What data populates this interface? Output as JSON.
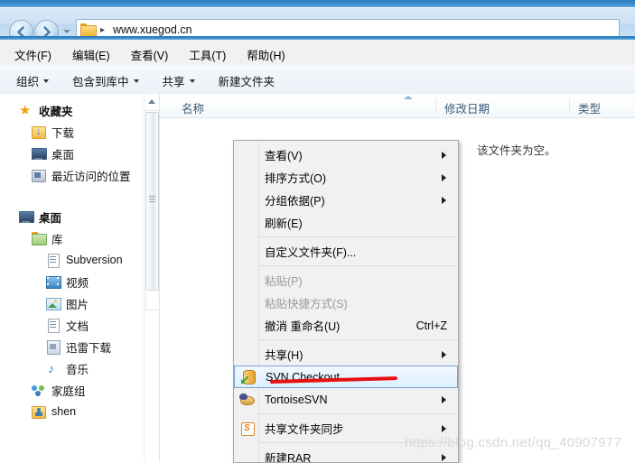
{
  "window": {
    "address_path": "www.xuegod.cn",
    "path_separator": "▸",
    "back_icon": "back-arrow-icon",
    "forward_icon": "forward-arrow-icon",
    "history_dropdown_icon": "chevron-down-icon",
    "folder_icon": "folder-icon"
  },
  "menubar": {
    "items": [
      {
        "label": "文件(F)",
        "name": "menu-file"
      },
      {
        "label": "编辑(E)",
        "name": "menu-edit"
      },
      {
        "label": "查看(V)",
        "name": "menu-view"
      },
      {
        "label": "工具(T)",
        "name": "menu-tools"
      },
      {
        "label": "帮助(H)",
        "name": "menu-help"
      }
    ]
  },
  "commandbar": {
    "items": [
      {
        "label": "组织",
        "caret": true,
        "name": "cmd-organize"
      },
      {
        "label": "包含到库中",
        "caret": true,
        "name": "cmd-include-in-library"
      },
      {
        "label": "共享",
        "caret": true,
        "name": "cmd-share"
      },
      {
        "label": "新建文件夹",
        "caret": false,
        "name": "cmd-new-folder"
      }
    ]
  },
  "sidebar": {
    "items": [
      {
        "label": "收藏夹",
        "level": 0,
        "icon": "star-icon",
        "name": "sidebar-item-favorites"
      },
      {
        "label": "下载",
        "level": 1,
        "icon": "downloads-icon",
        "name": "sidebar-item-downloads"
      },
      {
        "label": "桌面",
        "level": 1,
        "icon": "desktop-icon",
        "name": "sidebar-item-desktop-fav"
      },
      {
        "label": "最近访问的位置",
        "level": 1,
        "icon": "recent-places-icon",
        "name": "sidebar-item-recent-places"
      },
      {
        "label": "__GAP__",
        "level": 0,
        "icon": "",
        "name": "sidebar-gap"
      },
      {
        "label": "桌面",
        "level": 0,
        "icon": "desktop-icon",
        "name": "sidebar-item-desktop"
      },
      {
        "label": "库",
        "level": 1,
        "icon": "library-icon",
        "name": "sidebar-item-libraries"
      },
      {
        "label": "Subversion",
        "level": 2,
        "icon": "document-icon",
        "name": "sidebar-item-subversion"
      },
      {
        "label": "视频",
        "level": 2,
        "icon": "video-icon",
        "name": "sidebar-item-videos"
      },
      {
        "label": "图片",
        "level": 2,
        "icon": "pictures-icon",
        "name": "sidebar-item-pictures"
      },
      {
        "label": "文档",
        "level": 2,
        "icon": "documents-icon",
        "name": "sidebar-item-documents"
      },
      {
        "label": "迅雷下载",
        "level": 2,
        "icon": "xunlei-download-icon",
        "name": "sidebar-item-xunlei"
      },
      {
        "label": "音乐",
        "level": 2,
        "icon": "music-icon",
        "name": "sidebar-item-music"
      },
      {
        "label": "家庭组",
        "level": 1,
        "icon": "homegroup-icon",
        "name": "sidebar-item-homegroup"
      },
      {
        "label": "shen",
        "level": 1,
        "icon": "user-folder-icon",
        "name": "sidebar-item-user-shen"
      }
    ],
    "scrollbar": {
      "up_icon": "scroll-up-arrow-icon",
      "grip_icon": "scroll-thumb-grip-icon"
    }
  },
  "filepane": {
    "columns": [
      {
        "label": "名称",
        "name": "column-header-name"
      },
      {
        "label": "修改日期",
        "name": "column-header-date-modified"
      },
      {
        "label": "类型",
        "name": "column-header-type"
      }
    ],
    "sort_indicator_icon": "sort-ascending-icon",
    "empty_message": "该文件夹为空。"
  },
  "context_menu": {
    "items": [
      {
        "label": "查看(V)",
        "submenu": true,
        "disabled": false,
        "icon": "",
        "name": "ctx-view"
      },
      {
        "label": "排序方式(O)",
        "submenu": true,
        "disabled": false,
        "icon": "",
        "name": "ctx-sort-by"
      },
      {
        "label": "分组依据(P)",
        "submenu": true,
        "disabled": false,
        "icon": "",
        "name": "ctx-group-by"
      },
      {
        "label": "刷新(E)",
        "submenu": false,
        "disabled": false,
        "icon": "",
        "name": "ctx-refresh"
      },
      {
        "separator": true,
        "name": "ctx-separator-1"
      },
      {
        "label": "自定义文件夹(F)...",
        "submenu": false,
        "disabled": false,
        "icon": "",
        "name": "ctx-customize-folder"
      },
      {
        "separator": true,
        "name": "ctx-separator-2"
      },
      {
        "label": "粘贴(P)",
        "submenu": false,
        "disabled": true,
        "icon": "",
        "name": "ctx-paste"
      },
      {
        "label": "粘贴快捷方式(S)",
        "submenu": false,
        "disabled": true,
        "icon": "",
        "name": "ctx-paste-shortcut"
      },
      {
        "label": "撤消 重命名(U)",
        "submenu": false,
        "disabled": false,
        "accel": "Ctrl+Z",
        "icon": "",
        "name": "ctx-undo-rename"
      },
      {
        "separator": true,
        "name": "ctx-separator-3"
      },
      {
        "label": "共享(H)",
        "submenu": true,
        "disabled": false,
        "icon": "",
        "name": "ctx-share"
      },
      {
        "label": "SVN Checkout",
        "submenu": false,
        "disabled": false,
        "icon": "svn-checkout-icon",
        "selected": true,
        "name": "ctx-svn-checkout"
      },
      {
        "label": "TortoiseSVN",
        "submenu": true,
        "disabled": false,
        "icon": "tortoisesvn-icon",
        "name": "ctx-tortoisesvn"
      },
      {
        "separator": true,
        "name": "ctx-separator-4"
      },
      {
        "label": "共享文件夹同步",
        "submenu": true,
        "disabled": false,
        "icon": "sync-folder-icon",
        "name": "ctx-shared-folder-sync"
      },
      {
        "separator": true,
        "name": "ctx-separator-5"
      },
      {
        "label": "新建RAR",
        "submenu": true,
        "disabled": false,
        "icon": "",
        "name": "ctx-new-rar"
      }
    ]
  },
  "annotation": {
    "type": "red-underline",
    "color": "#e81010",
    "target": "SVN Checkout"
  },
  "watermark": {
    "text": "https://blog.csdn.net/qq_40907977"
  }
}
